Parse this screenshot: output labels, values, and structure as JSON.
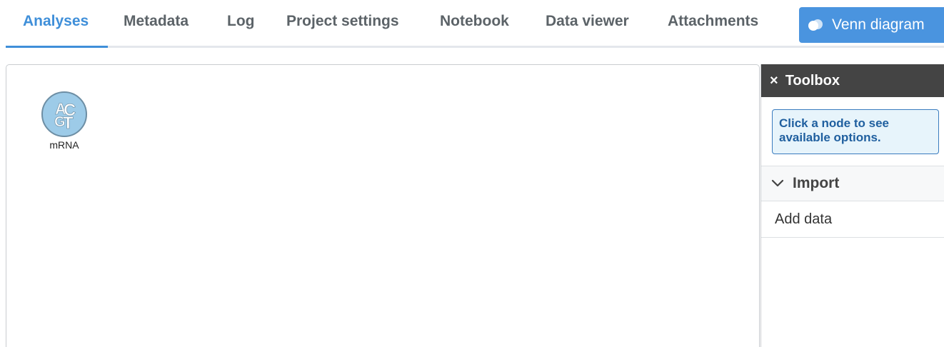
{
  "tabs": [
    {
      "label": "Analyses",
      "active": true
    },
    {
      "label": "Metadata",
      "active": false
    },
    {
      "label": "Log",
      "active": false
    },
    {
      "label": "Project settings",
      "active": false
    },
    {
      "label": "Notebook",
      "active": false
    },
    {
      "label": "Data viewer",
      "active": false
    },
    {
      "label": "Attachments",
      "active": false
    }
  ],
  "venn_button": {
    "label": "Venn diagram",
    "icon": "venn-icon"
  },
  "canvas": {
    "nodes": [
      {
        "label": "mRNA",
        "icon": "acgt-icon",
        "icon_letters": "ACGT",
        "color": "#9dcbe8"
      }
    ]
  },
  "toolbox": {
    "title": "Toolbox",
    "close_icon": "close-icon",
    "info": "Click a node to see available options.",
    "section": {
      "label": "Import",
      "icon": "chevron-down-icon",
      "expanded": true
    },
    "items": [
      {
        "label": "Add data"
      }
    ]
  },
  "colors": {
    "accent": "#3f8fd9",
    "button": "#4a94df",
    "toolbox_header": "#444444",
    "info_bg": "#e7f4fb",
    "info_text": "#1f5f9f"
  }
}
